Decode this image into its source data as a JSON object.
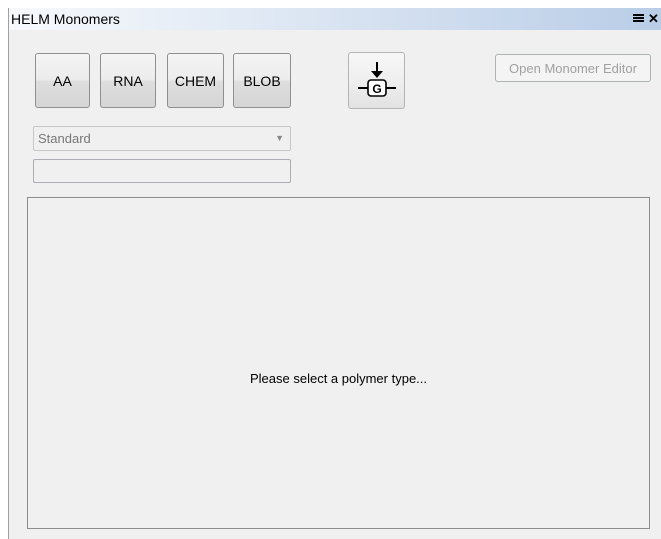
{
  "window": {
    "title": "HELM Monomers",
    "menu_icon": "menu-bars-icon",
    "close_glyph": "✕"
  },
  "toolbar": {
    "polymer_buttons": [
      {
        "label": "AA"
      },
      {
        "label": "RNA"
      },
      {
        "label": "CHEM"
      },
      {
        "label": "BLOB"
      }
    ],
    "g_button_icon": "insert-g-monomer-icon",
    "g_button_letter": "G",
    "open_editor_label": "Open Monomer Editor"
  },
  "filters": {
    "category_selected": "Standard",
    "search_value": "",
    "search_placeholder": ""
  },
  "content": {
    "message": "Please select a polymer type..."
  },
  "colors": {
    "titlebar_gradient": [
      "#f7f9fc",
      "#b9cde7"
    ],
    "panel_bg": "#f0f0f0",
    "disabled_text": "#a0a0a0"
  }
}
